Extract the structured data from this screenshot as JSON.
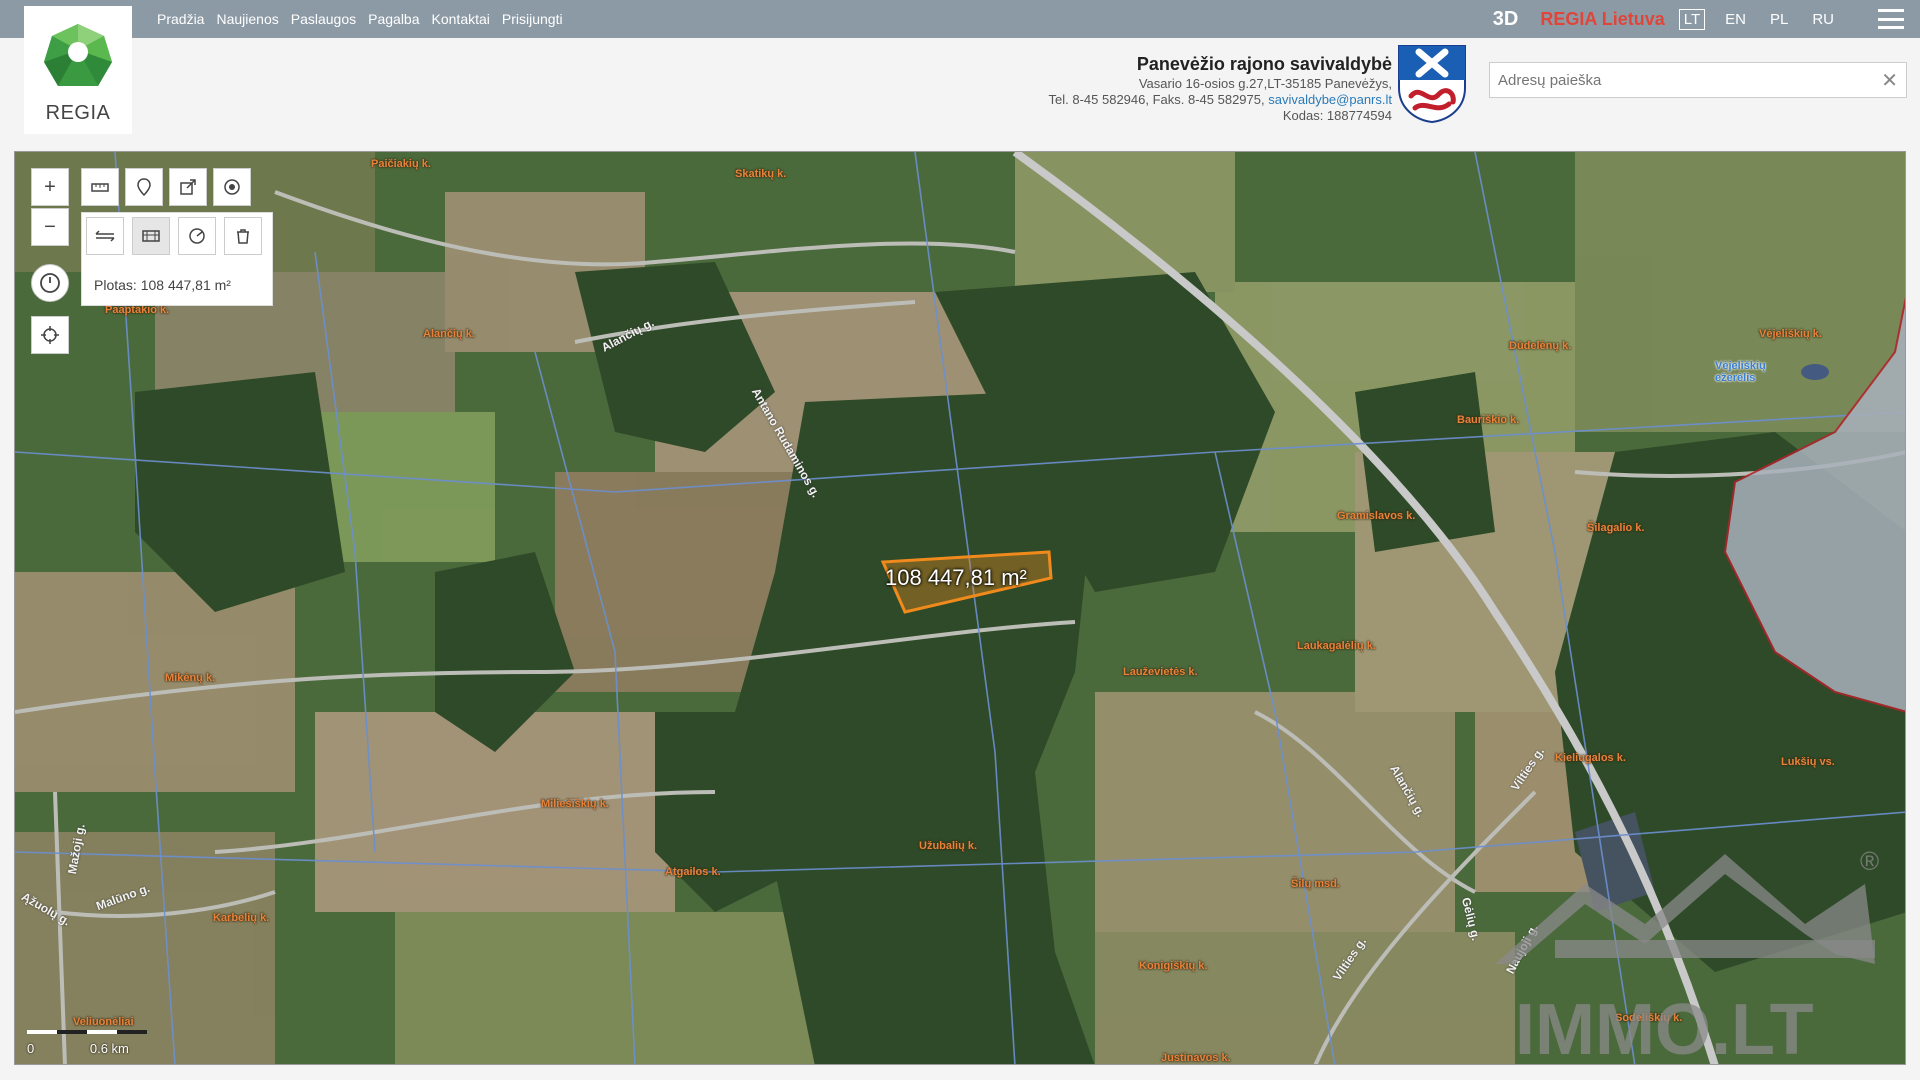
{
  "nav": {
    "items": [
      "Pradžia",
      "Naujienos",
      "Paslaugos",
      "Pagalba",
      "Kontaktai",
      "Prisijungti"
    ],
    "btn_3d": "3D",
    "regia_lietuva": "REGIA Lietuva",
    "languages": [
      "LT",
      "EN",
      "PL",
      "RU"
    ],
    "active_language": "LT"
  },
  "logo": {
    "text": "REGIA"
  },
  "municipality": {
    "title": "Panevėžio rajono savivaldybė",
    "address": "Vasario 16-osios g.27,LT-35185 Panevėžys,",
    "phone_prefix": "Tel. 8-45 582946, Faks. 8-45 582975, ",
    "email": "savivaldybe@panrs.lt",
    "code": "Kodas: 188774594"
  },
  "search": {
    "placeholder": "Adresų paieška",
    "value": "",
    "clear_symbol": "✕"
  },
  "map": {
    "area_label": "108 447,81 m²",
    "measure_result": "Plotas: 108 447,81 m²",
    "scale_zero": "0",
    "scale_km": "0.6 km",
    "place_names": [
      "Paičiakių k.",
      "Skatikų k.",
      "Paaptakio k.",
      "Alančių k.",
      "Dūdelėnų k.",
      "Vėjeliškių k.",
      "Bauriškio k.",
      "Gramislavos k.",
      "Šilagalio k.",
      "Laukagalėlių k.",
      "Lauževietės k.",
      "Mikėnų k.",
      "Kieliugalos k.",
      "Lukšių vs.",
      "Miliešiškių k.",
      "Užubalių k.",
      "Atgailos k.",
      "Karbelių k.",
      "Šilų msd.",
      "Konigiškių k.",
      "Veliuonėliai",
      "Justinavos k.",
      "Sodeliškių k."
    ],
    "lake_name": "Vėjeliškių ežerėlis",
    "road_names": [
      "Antano Rudaminos g.",
      "Alančių g.",
      "Alančių g.",
      "Vilties g.",
      "Vilties g.",
      "Gėlių g.",
      "Naujoji g.",
      "Malūno g.",
      "Mažoji g.",
      "Ąžuolų g."
    ],
    "watermark_text": "IMMO.LT",
    "watermark_symbol": "®"
  },
  "colors": {
    "nav_bg": "#8c9aa6",
    "regia_red": "#e0453a",
    "selection_orange": "#f08a1c",
    "boundary_red": "#b4232b",
    "place_label": "#e8823a"
  },
  "icons": [
    "plus-icon",
    "minus-icon",
    "ruler-icon",
    "marker-icon",
    "share-icon",
    "locate-icon",
    "measure-line-icon",
    "measure-area-icon",
    "measure-circle-icon",
    "trash-icon",
    "history-icon",
    "crosshair-icon"
  ]
}
